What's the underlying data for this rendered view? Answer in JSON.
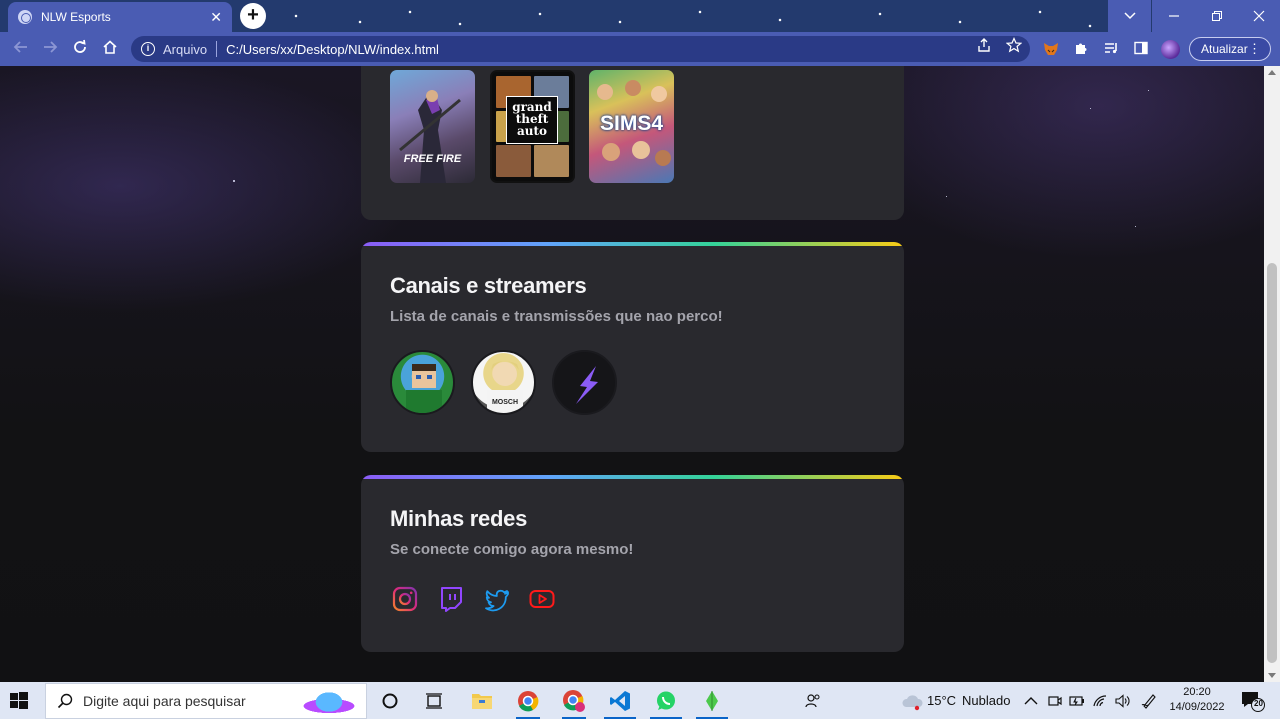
{
  "browser": {
    "tab_title": "NLW Esports",
    "tab_close": "✕",
    "new_tab": "+",
    "address_scheme": "Arquivo",
    "address_url": "C:/Users/xx/Desktop/NLW/index.html",
    "update_label": "Atualizar"
  },
  "games_section": {
    "covers": [
      {
        "name": "Free Fire",
        "text": "FREE FIRE"
      },
      {
        "name": "Grand Theft Auto V",
        "text": "grand theft auto"
      },
      {
        "name": "The Sims 4",
        "text": "SIMS4"
      }
    ]
  },
  "streamers_section": {
    "title": "Canais e streamers",
    "subtitle": "Lista de canais e transmissões que nao perco!"
  },
  "networks_section": {
    "title": "Minhas redes",
    "subtitle": "Se conecte comigo agora mesmo!",
    "links": [
      {
        "icon": "instagram-icon",
        "color": "#e1306c"
      },
      {
        "icon": "twitch-icon",
        "color": "#9146ff"
      },
      {
        "icon": "twitter-icon",
        "color": "#1d9bf0"
      },
      {
        "icon": "youtube-icon",
        "color": "#ff0000"
      }
    ]
  },
  "taskbar": {
    "search_placeholder": "Digite aqui para pesquisar",
    "weather_temp": "15°C",
    "weather_text": "Nublado",
    "time": "20:20",
    "date": "14/09/2022",
    "notification_count": "20"
  }
}
